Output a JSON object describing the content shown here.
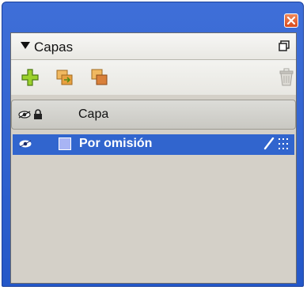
{
  "panel": {
    "title": "Capas",
    "column_header": "Capa",
    "layers": [
      {
        "name": "Por omisión",
        "selected": true,
        "color": "#a8b4f4"
      }
    ]
  },
  "colors": {
    "titlebar": "#2f63d2",
    "selection": "#3165ce",
    "panel_bg": "#d4d0c8",
    "close_button": "#e0602c"
  },
  "icons": {
    "close": "close-icon",
    "collapse": "triangle-down-icon",
    "options": "panel-options-icon",
    "new_layer": "plus-icon",
    "new_sublayer": "new-sublayer-icon",
    "duplicate": "duplicate-layer-icon",
    "delete": "trash-icon"
  }
}
